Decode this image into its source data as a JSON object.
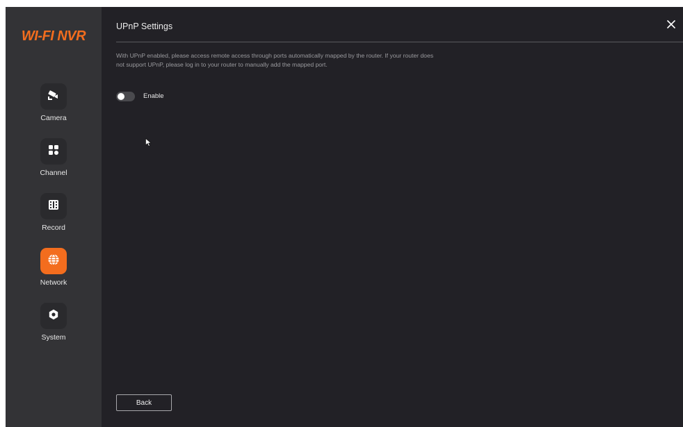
{
  "app": {
    "logo_text": "WI-FI NVR",
    "accent_color": "#f36d1e"
  },
  "sidebar": {
    "items": [
      {
        "label": "Camera",
        "icon": "camera-icon",
        "active": false
      },
      {
        "label": "Channel",
        "icon": "channel-grid-icon",
        "active": false
      },
      {
        "label": "Record",
        "icon": "film-icon",
        "active": false
      },
      {
        "label": "Network",
        "icon": "globe-icon",
        "active": true
      },
      {
        "label": "System",
        "icon": "gear-icon",
        "active": false
      }
    ]
  },
  "page": {
    "title": "UPnP Settings",
    "description": "With UPnP enabled, please access remote access through ports automatically mapped by the router. If your router does not support UPnP, please log in to your router to manually add the mapped port.",
    "enable": {
      "label": "Enable",
      "state": "off"
    },
    "back_label": "Back",
    "close_icon": "close-icon"
  }
}
